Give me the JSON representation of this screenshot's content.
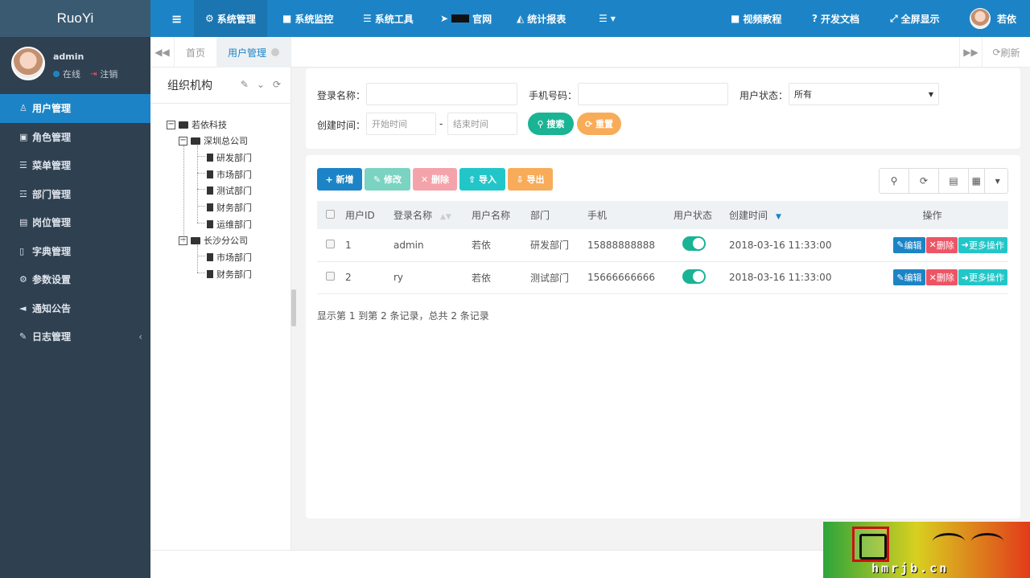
{
  "app": {
    "logo": "RuoYi"
  },
  "user": {
    "name": "admin",
    "online": "在线",
    "logout": "注销",
    "top_name": "若依"
  },
  "sidebar": {
    "items": [
      {
        "label": "用户管理",
        "icon": "user-icon"
      },
      {
        "label": "角色管理",
        "icon": "lock-icon"
      },
      {
        "label": "菜单管理",
        "icon": "list-icon"
      },
      {
        "label": "部门管理",
        "icon": "outdent-icon"
      },
      {
        "label": "岗位管理",
        "icon": "id-card-icon"
      },
      {
        "label": "字典管理",
        "icon": "bookmark-icon"
      },
      {
        "label": "参数设置",
        "icon": "gear-icon"
      },
      {
        "label": "通知公告",
        "icon": "bullhorn-icon"
      },
      {
        "label": "日志管理",
        "icon": "edit-icon"
      }
    ]
  },
  "topnav": {
    "menu": "≡",
    "items": [
      "系统管理",
      "系统监控",
      "系统工具",
      "官网",
      "统计报表"
    ],
    "right": [
      "视频教程",
      "开发文档",
      "全屏显示"
    ]
  },
  "tabs": {
    "home": "首页",
    "current": "用户管理",
    "refresh": "刷新"
  },
  "tree": {
    "title": "组织机构",
    "nodes": [
      {
        "label": "若依科技"
      },
      {
        "label": "深圳总公司"
      },
      {
        "label": "研发部门"
      },
      {
        "label": "市场部门"
      },
      {
        "label": "测试部门"
      },
      {
        "label": "财务部门"
      },
      {
        "label": "运维部门"
      },
      {
        "label": "长沙分公司"
      },
      {
        "label": "市场部门"
      },
      {
        "label": "财务部门"
      }
    ]
  },
  "search": {
    "login_name_label": "登录名称：",
    "phone_label": "手机号码：",
    "status_label": "用户状态：",
    "status_value": "所有",
    "created_label": "创建时间：",
    "start_placeholder": "开始时间",
    "end_placeholder": "结束时间",
    "dash": "-",
    "search_btn": "搜索",
    "reset_btn": "重置"
  },
  "toolbar": {
    "add": "新增",
    "edit": "修改",
    "delete": "删除",
    "import": "导入",
    "export": "导出"
  },
  "table": {
    "columns": [
      "用户ID",
      "登录名称",
      "用户名称",
      "部门",
      "手机",
      "用户状态",
      "创建时间",
      "操作"
    ],
    "rows": [
      {
        "id": "1",
        "login": "admin",
        "name": "若依",
        "dept": "研发部门",
        "phone": "15888888888",
        "created": "2018-03-16 11:33:00",
        "enabled": true
      },
      {
        "id": "2",
        "login": "ry",
        "name": "若依",
        "dept": "测试部门",
        "phone": "15666666666",
        "created": "2018-03-16 11:33:00",
        "enabled": true
      }
    ],
    "row_actions": {
      "edit": "编辑",
      "delete": "删除",
      "more": "更多操作"
    },
    "page_info": "显示第 1 到第 2 条记录，总共 2 条记录"
  },
  "watermark": {
    "domain": "hmrjb.cn"
  },
  "colors": {
    "primary": "#1c84c6",
    "sidebar": "#2f4050",
    "success": "#1ab394",
    "danger": "#ed5565",
    "info": "#23c6c8",
    "warning": "#f8ac59"
  }
}
